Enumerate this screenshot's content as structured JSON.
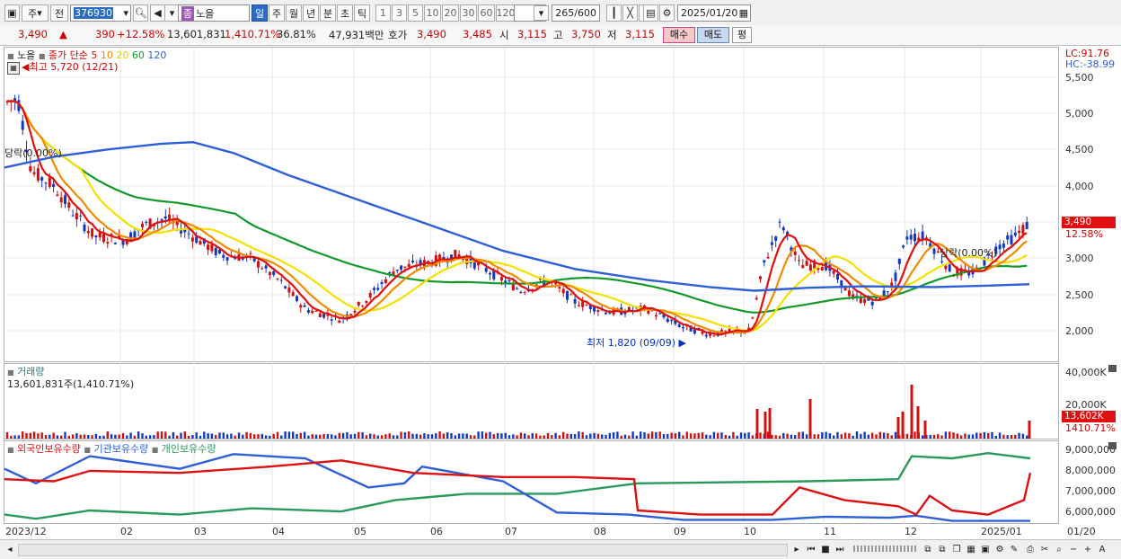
{
  "toolbar": {
    "period_type": "주",
    "market": "전",
    "code": "376930",
    "name_badge": "종",
    "name": "노을",
    "period_tabs": [
      "일",
      "주",
      "월",
      "년",
      "분",
      "초",
      "틱"
    ],
    "active_tab": "일",
    "numbers": [
      "1",
      "3",
      "5",
      "10",
      "20",
      "30",
      "60",
      "120"
    ],
    "count": "265",
    "count_total": "/600",
    "date": "2025/01/20"
  },
  "quote": {
    "price": "3,490",
    "change": "390",
    "change_pct": "+12.58%",
    "volume": "13,601,831",
    "volume_ratio": "1,410.71%",
    "turnover": "36.81%",
    "amount": "47,931백만",
    "hoga_label": "호가",
    "ask": "3,490",
    "bid": "3,485",
    "open_label": "시",
    "open": "3,115",
    "high_label": "고",
    "high": "3,750",
    "low_label": "저",
    "low": "3,115",
    "buy_label": "매수",
    "sell_label": "매도",
    "avg_label": "평"
  },
  "price_panel": {
    "legend_name": "노을",
    "legend_ma": "종가 단순",
    "ma_periods": [
      "5",
      "10",
      "20",
      "60",
      "120"
    ],
    "high_note": "최고 5,720 (12/21)",
    "low_note": "최저 1,820 (09/09)",
    "left_note": "당락(0.00%)",
    "right_note": "당락(0.00%)",
    "lc": "LC:91.76",
    "hc": "HC:-38.99",
    "price_tag": "3,490",
    "pct_tag": "12.58%",
    "y_ticks": [
      "5,500",
      "5,000",
      "4,500",
      "4,000",
      "3,500",
      "3,000",
      "2,500",
      "2,000"
    ]
  },
  "volume_panel": {
    "title": "거래량",
    "value": "13,601,831주(1,410.71%)",
    "y_ticks": [
      "40,000K",
      "20,000K"
    ],
    "tag": "13,602K",
    "tag_pct": "1410.71%"
  },
  "holding_panel": {
    "legend": [
      "외국인보유수량",
      "기관보유수량",
      "개인보유수량"
    ],
    "y_ticks": [
      "9,000,000",
      "8,000,000",
      "7,000,000",
      "6,000,000"
    ]
  },
  "x_labels": [
    "2023/12",
    "02",
    "03",
    "04",
    "05",
    "06",
    "07",
    "08",
    "09",
    "10",
    "11",
    "12",
    "2025/01",
    "01/20"
  ],
  "colors": {
    "ma5": "#e01010",
    "ma10": "#f08a00",
    "ma20": "#f5e000",
    "ma60": "#119a2a",
    "ma120": "#2e5fd8",
    "foreign": "#dd1111",
    "institution": "#2e5fd8",
    "individual": "#2a9a5a",
    "up": "#d01010",
    "down": "#1038c0"
  }
}
